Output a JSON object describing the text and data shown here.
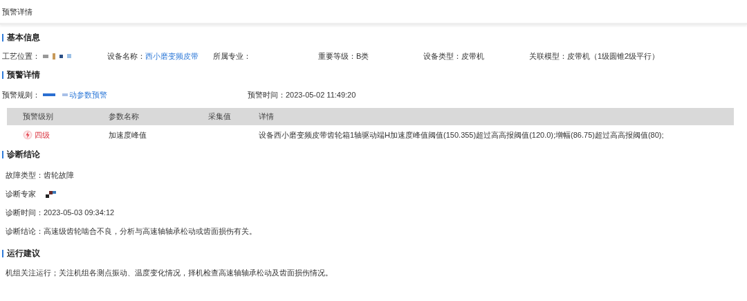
{
  "header": {
    "title": "预警详情"
  },
  "basic_info": {
    "heading": "基本信息",
    "fields": [
      {
        "label": "工艺位置：",
        "redacted": true,
        "link": false
      },
      {
        "label": "设备名称：",
        "value": "西小磨变频皮带",
        "link": true,
        "redacted": false
      },
      {
        "label": "所属专业：",
        "link": false,
        "redacted": false
      },
      {
        "label": "重要等级：",
        "value": "B类",
        "link": false,
        "redacted": false
      },
      {
        "label": "设备类型：",
        "value": "皮带机",
        "link": false,
        "redacted": false
      },
      {
        "label": "关联模型：",
        "value": "皮带机（1级圆锥2级平行）",
        "link": false,
        "redacted": false
      }
    ]
  },
  "alert_details": {
    "heading": "预警详情",
    "fields": [
      {
        "label": "预警规则：",
        "value": "动参数预警",
        "link": true,
        "redacted": true
      },
      {
        "label": "预警时间：",
        "value": "2023-05-02 11:49:20",
        "link": false,
        "redacted": false
      }
    ],
    "table": {
      "columns": [
        "预警级别",
        "参数名称",
        "采集值",
        "详情"
      ],
      "rows": [
        {
          "level": "四级",
          "parameter": "加速度峰值",
          "detail": "设备西小磨变频皮带齿轮箱1轴驱动端H加速度峰值阈值(150.355)超过高高报阈值(120.0);增幅(86.75)超过高高报阈值(80);"
        }
      ]
    }
  },
  "diagnosis": {
    "heading": "诊断结论",
    "fields": [
      {
        "label": "故障类型：",
        "value": "齿轮故障",
        "redacted": false
      },
      {
        "label": "诊断专家",
        "redacted": true
      },
      {
        "label": "诊断时间：",
        "value": "2023-05-03 09:34:12",
        "redacted": false
      },
      {
        "label": "诊断结论：",
        "value": "高速级齿轮啮合不良，分析与高速轴轴承松动或齿面损伤有关。",
        "redacted": false
      }
    ]
  },
  "suggestion": {
    "heading": "运行建议",
    "text": "机组关注运行；关注机组各测点振动、温度变化情况，择机检查高速轴轴承松动及齿面损伤情况。"
  }
}
